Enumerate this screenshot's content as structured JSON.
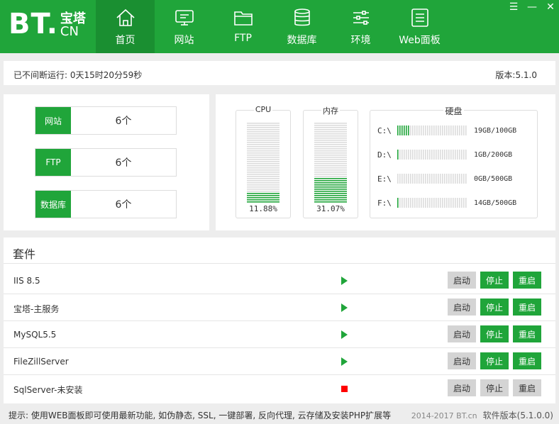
{
  "colors": {
    "brand": "#20a53a",
    "brand_dark": "#1a8f31",
    "bar_empty": "#dcdcdc",
    "stopped": "#ff0000"
  },
  "logo": {
    "bt": "BT.",
    "cn1": "宝塔",
    "cn2": "CN"
  },
  "nav": [
    {
      "label": "首页",
      "icon": "home-icon",
      "active": true
    },
    {
      "label": "网站",
      "icon": "monitor-icon"
    },
    {
      "label": "FTP",
      "icon": "folder-icon"
    },
    {
      "label": "数据库",
      "icon": "database-icon"
    },
    {
      "label": "环境",
      "icon": "sliders-icon"
    },
    {
      "label": "Web面板",
      "icon": "list-icon"
    }
  ],
  "window_controls": {
    "menu": "☰",
    "minimize": "—",
    "close": "✕"
  },
  "status": {
    "uptime": "已不间断运行: 0天15时20分59秒",
    "version": "版本:5.1.0"
  },
  "counts": [
    {
      "label": "网站",
      "value": "6个"
    },
    {
      "label": "FTP",
      "value": "6个"
    },
    {
      "label": "数据库",
      "value": "6个"
    }
  ],
  "gauges": [
    {
      "title": "CPU",
      "value": "11.88%",
      "fraction": 0.1188
    },
    {
      "title": "内存",
      "value": "31.07%",
      "fraction": 0.3107
    }
  ],
  "disks": {
    "title": "硬盘",
    "items": [
      {
        "label": "C:\\",
        "value": "19GB/100GB",
        "fraction": 0.19
      },
      {
        "label": "D:\\",
        "value": "1GB/200GB",
        "fraction": 0.005
      },
      {
        "label": "E:\\",
        "value": "0GB/500GB",
        "fraction": 0.0
      },
      {
        "label": "F:\\",
        "value": "14GB/500GB",
        "fraction": 0.028
      }
    ]
  },
  "suites": {
    "title": "套件",
    "buttons": {
      "start": "启动",
      "stop": "停止",
      "restart": "重启"
    },
    "items": [
      {
        "name": "IIS 8.5",
        "status": "running"
      },
      {
        "name": "宝塔-主服务",
        "status": "running"
      },
      {
        "name": "MySQL5.5",
        "status": "running"
      },
      {
        "name": "FileZillServer",
        "status": "running"
      },
      {
        "name": "SqlServer-未安装",
        "status": "stopped"
      }
    ]
  },
  "footer": {
    "tip": "提示: 使用WEB面板即可使用最新功能, 如伪静态, SSL, 一键部署, 反向代理, 云存储及安装PHP扩展等",
    "copyright": "2014-2017 BT.cn",
    "software_version": "软件版本(5.1.0.0)"
  }
}
